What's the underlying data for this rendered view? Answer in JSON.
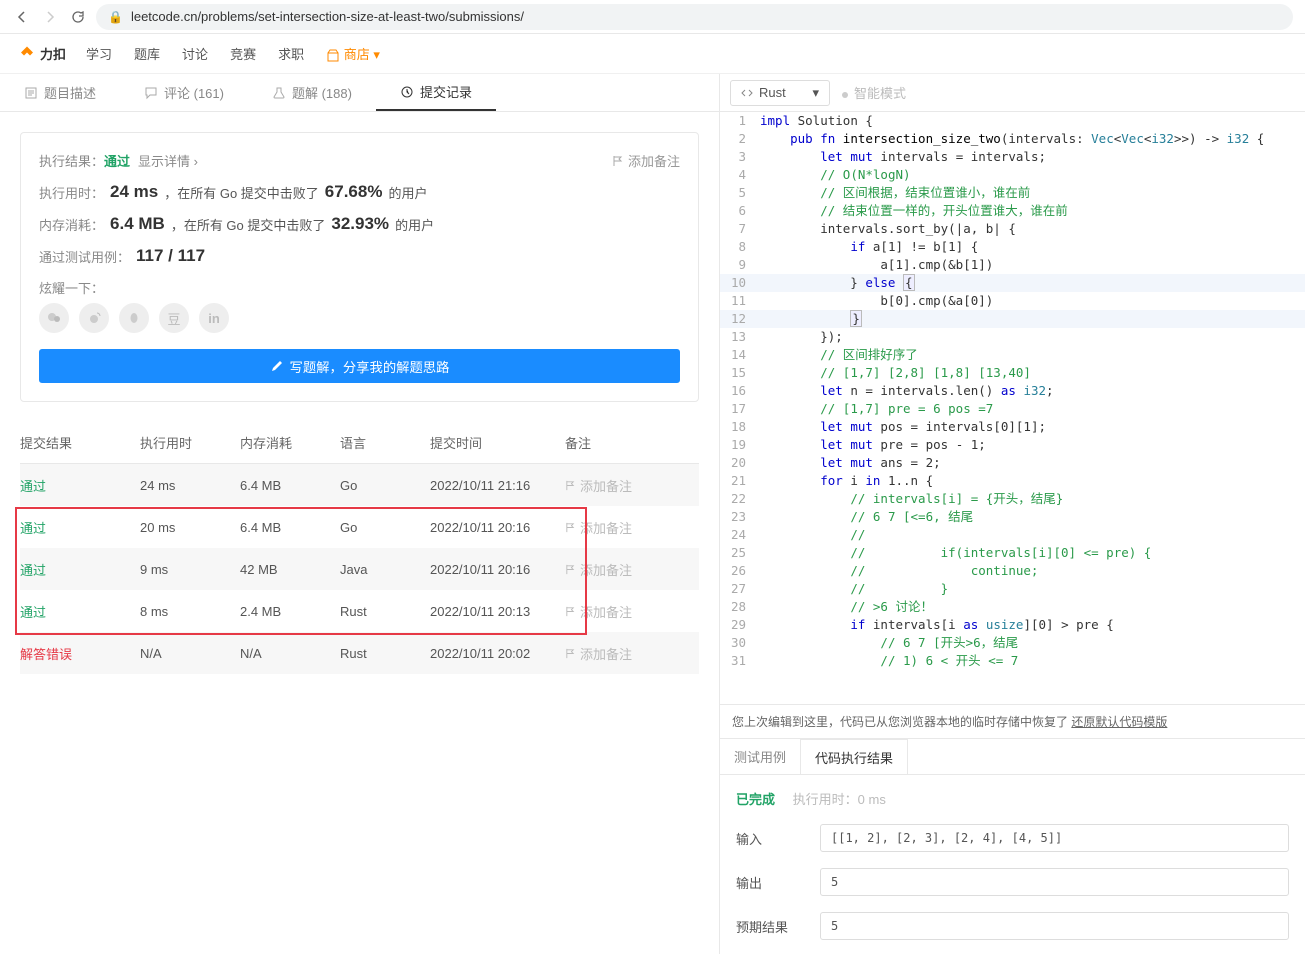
{
  "browser": {
    "url": "leetcode.cn/problems/set-intersection-size-at-least-two/submissions/"
  },
  "nav": {
    "brand": "力扣",
    "items": [
      "学习",
      "题库",
      "讨论",
      "竞赛",
      "求职"
    ],
    "store": "商店"
  },
  "tabs": {
    "desc": "题目描述",
    "comments": "评论 (161)",
    "solutions": "题解 (188)",
    "submissions": "提交记录"
  },
  "result": {
    "label": "执行结果：",
    "status": "通过",
    "detail": "显示详情",
    "add_note": "添加备注",
    "time_label": "执行用时：",
    "time": "24 ms",
    "time_desc1": "，在所有 Go 提交中击败了 ",
    "time_pct": "67.68%",
    "time_desc2": " 的用户",
    "mem_label": "内存消耗：",
    "mem": "6.4 MB",
    "mem_desc1": "，在所有 Go 提交中击败了 ",
    "mem_pct": "32.93%",
    "mem_desc2": " 的用户",
    "case_label": "通过测试用例：",
    "case": "117 / 117",
    "brag": "炫耀一下：",
    "write": "写题解，分享我的解题思路"
  },
  "table": {
    "headers": [
      "提交结果",
      "执行用时",
      "内存消耗",
      "语言",
      "提交时间",
      "备注"
    ],
    "note_btn": "添加备注",
    "rows": [
      {
        "status": "通过",
        "pass": true,
        "time": "24 ms",
        "mem": "6.4 MB",
        "lang": "Go",
        "ts": "2022/10/11 21:16",
        "hl": true
      },
      {
        "status": "通过",
        "pass": true,
        "time": "20 ms",
        "mem": "6.4 MB",
        "lang": "Go",
        "ts": "2022/10/11 20:16"
      },
      {
        "status": "通过",
        "pass": true,
        "time": "9 ms",
        "mem": "42 MB",
        "lang": "Java",
        "ts": "2022/10/11 20:16",
        "hl": true
      },
      {
        "status": "通过",
        "pass": true,
        "time": "8 ms",
        "mem": "2.4 MB",
        "lang": "Rust",
        "ts": "2022/10/11 20:13"
      },
      {
        "status": "解答错误",
        "pass": false,
        "time": "N/A",
        "mem": "N/A",
        "lang": "Rust",
        "ts": "2022/10/11 20:02",
        "hl": true
      }
    ]
  },
  "editor": {
    "lang": "Rust",
    "hint": "智能模式",
    "lines": [
      [
        [
          "kw",
          "impl"
        ],
        [
          "",
          " Solution {"
        ]
      ],
      [
        [
          "",
          "    "
        ],
        [
          "kw",
          "pub fn"
        ],
        [
          "",
          " "
        ],
        [
          "fn",
          "intersection_size_two"
        ],
        [
          "",
          "(intervals: "
        ],
        [
          "ty",
          "Vec"
        ],
        [
          "",
          "<"
        ],
        [
          "ty",
          "Vec"
        ],
        [
          "",
          "<"
        ],
        [
          "ty",
          "i32"
        ],
        [
          "",
          ">>"
        ],
        [
          "",
          ") -> "
        ],
        [
          "ty",
          "i32"
        ],
        [
          "",
          " {"
        ]
      ],
      [
        [
          "",
          "        "
        ],
        [
          "kw",
          "let mut"
        ],
        [
          "",
          " intervals = intervals;"
        ]
      ],
      [
        [
          "",
          "        "
        ],
        [
          "cm",
          "// O(N*logN)"
        ]
      ],
      [
        [
          "",
          "        "
        ],
        [
          "cm",
          "// 区间根据，结束位置谁小，谁在前"
        ]
      ],
      [
        [
          "",
          "        "
        ],
        [
          "cm",
          "// 结束位置一样的，开头位置谁大，谁在前"
        ]
      ],
      [
        [
          "",
          "        intervals.sort_by(|a, b| {"
        ]
      ],
      [
        [
          "",
          "            "
        ],
        [
          "kw",
          "if"
        ],
        [
          "",
          " a[1] != b[1] {"
        ]
      ],
      [
        [
          "",
          "                a[1].cmp(&b[1])"
        ]
      ],
      [
        [
          "",
          "            } "
        ],
        [
          "kw",
          "else"
        ],
        [
          "",
          " "
        ],
        [
          "cur",
          "{"
        ]
      ],
      [
        [
          "",
          "                b[0].cmp(&a[0])"
        ]
      ],
      [
        [
          "",
          "            "
        ],
        [
          "cur",
          "}"
        ]
      ],
      [
        [
          "",
          "        });"
        ]
      ],
      [
        [
          "",
          "        "
        ],
        [
          "cm",
          "// 区间排好序了"
        ]
      ],
      [
        [
          "",
          "        "
        ],
        [
          "cm",
          "// [1,7] [2,8] [1,8] [13,40]"
        ]
      ],
      [
        [
          "",
          "        "
        ],
        [
          "kw",
          "let"
        ],
        [
          "",
          " n = intervals.len() "
        ],
        [
          "kw",
          "as"
        ],
        [
          "",
          " "
        ],
        [
          "ty",
          "i32"
        ],
        [
          "",
          ";"
        ]
      ],
      [
        [
          "",
          "        "
        ],
        [
          "cm",
          "// [1,7] pre = 6 pos =7"
        ]
      ],
      [
        [
          "",
          "        "
        ],
        [
          "kw",
          "let mut"
        ],
        [
          "",
          " pos = intervals[0][1];"
        ]
      ],
      [
        [
          "",
          "        "
        ],
        [
          "kw",
          "let mut"
        ],
        [
          "",
          " pre = pos - 1;"
        ]
      ],
      [
        [
          "",
          "        "
        ],
        [
          "kw",
          "let mut"
        ],
        [
          "",
          " ans = 2;"
        ]
      ],
      [
        [
          "",
          "        "
        ],
        [
          "kw",
          "for"
        ],
        [
          "",
          " i "
        ],
        [
          "kw",
          "in"
        ],
        [
          "",
          " 1..n {"
        ]
      ],
      [
        [
          "",
          "            "
        ],
        [
          "cm",
          "// intervals[i] = {开头，结尾}"
        ]
      ],
      [
        [
          "",
          "            "
        ],
        [
          "cm",
          "// 6 7 [<=6, 结尾"
        ]
      ],
      [
        [
          "",
          "            "
        ],
        [
          "cm",
          "//"
        ]
      ],
      [
        [
          "",
          "            "
        ],
        [
          "cm",
          "//          if(intervals[i][0] <= pre) {"
        ]
      ],
      [
        [
          "",
          "            "
        ],
        [
          "cm",
          "//              continue;"
        ]
      ],
      [
        [
          "",
          "            "
        ],
        [
          "cm",
          "//          }"
        ]
      ],
      [
        [
          "",
          "            "
        ],
        [
          "cm",
          "// >6 讨论！"
        ]
      ],
      [
        [
          "",
          "            "
        ],
        [
          "kw",
          "if"
        ],
        [
          "",
          " intervals[i "
        ],
        [
          "kw",
          "as"
        ],
        [
          "",
          " "
        ],
        [
          "ty",
          "usize"
        ],
        [
          "",
          "][0] > pre {"
        ]
      ],
      [
        [
          "",
          "                "
        ],
        [
          "cm",
          "// 6 7 [开头>6，结尾"
        ]
      ],
      [
        [
          "",
          "                "
        ],
        [
          "cm",
          "// 1) 6 < 开头 <= 7"
        ]
      ]
    ]
  },
  "restore": {
    "text": "您上次编辑到这里，代码已从您浏览器本地的临时存储中恢复了 ",
    "link": "还原默认代码模版"
  },
  "bottom_tabs": {
    "test": "测试用例",
    "result": "代码执行结果"
  },
  "output": {
    "done": "已完成",
    "runtime_lbl": "执行用时：",
    "runtime": "0 ms",
    "input_lbl": "输入",
    "input": "[[1, 2], [2, 3], [2, 4], [4, 5]]",
    "output_lbl": "输出",
    "output_val": "5",
    "expected_lbl": "预期结果",
    "expected": "5"
  }
}
